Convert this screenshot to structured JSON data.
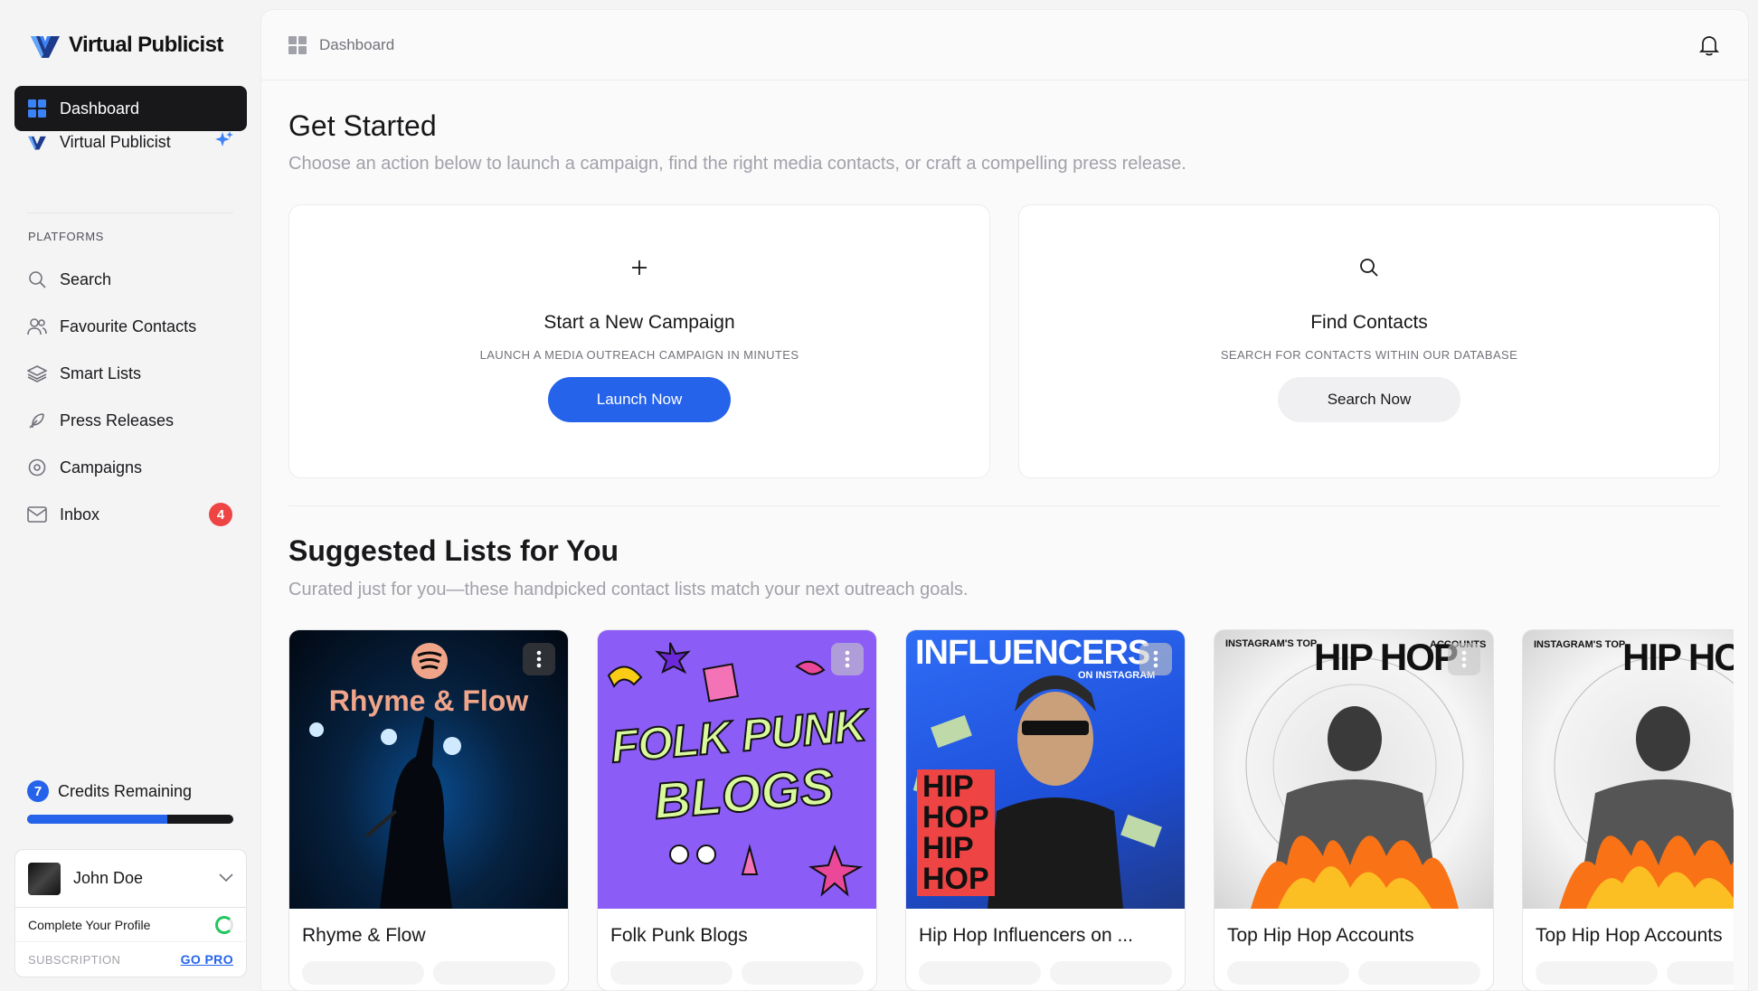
{
  "app": {
    "name": "Virtual Publicist"
  },
  "sidebar": {
    "items": [
      {
        "label": "Dashboard"
      },
      {
        "label": "Virtual Publicist"
      }
    ],
    "section_label": "PLATFORMS",
    "platforms": [
      {
        "label": "Search"
      },
      {
        "label": "Favourite Contacts"
      },
      {
        "label": "Smart Lists"
      },
      {
        "label": "Press Releases"
      },
      {
        "label": "Campaigns"
      },
      {
        "label": "Inbox",
        "badge": "4"
      }
    ],
    "credits": {
      "count": "7",
      "label": "Credits Remaining",
      "fill_fraction": 0.68
    },
    "profile": {
      "name": "John Doe",
      "complete_label": "Complete Your Profile",
      "subscription_label": "SUBSCRIPTION",
      "gopro_label": "GO PRO"
    }
  },
  "topbar": {
    "breadcrumb": "Dashboard"
  },
  "get_started": {
    "title": "Get Started",
    "subtitle": "Choose an action below to launch a campaign, find the right media contacts, or craft a compelling press release.",
    "cards": [
      {
        "icon": "plus-icon",
        "title": "Start a New Campaign",
        "subtitle": "LAUNCH A MEDIA OUTREACH CAMPAIGN IN MINUTES",
        "button": "Launch Now"
      },
      {
        "icon": "search-icon",
        "title": "Find Contacts",
        "subtitle": "SEARCH FOR CONTACTS WITHIN OUR DATABASE",
        "button": "Search Now"
      }
    ]
  },
  "suggested": {
    "title": "Suggested Lists for You",
    "subtitle": "Curated just for you—these handpicked contact lists match your next outreach goals.",
    "lists": [
      {
        "title": "Rhyme & Flow",
        "cover_text": "Rhyme & Flow"
      },
      {
        "title": "Folk Punk Blogs",
        "cover_text": [
          "FOLK PUNK",
          "BLOGS"
        ]
      },
      {
        "title": "Hip Hop Influencers on ...",
        "cover_text": [
          "INFLUENCERS",
          "ON INSTAGRAM",
          "HIP",
          "HOP",
          "HIP",
          "HOP"
        ]
      },
      {
        "title": "Top Hip Hop Accounts",
        "cover_text": [
          "INSTAGRAM'S TOP",
          "HIP HOP",
          "ACCOUNTS"
        ]
      },
      {
        "title": "Top Hip Hop Accounts",
        "cover_text": [
          "INSTAGRAM'S TOP",
          "HIP HOP"
        ]
      }
    ]
  },
  "colors": {
    "accent": "#2563eb",
    "badge": "#ef4444",
    "dark": "#18181b"
  }
}
